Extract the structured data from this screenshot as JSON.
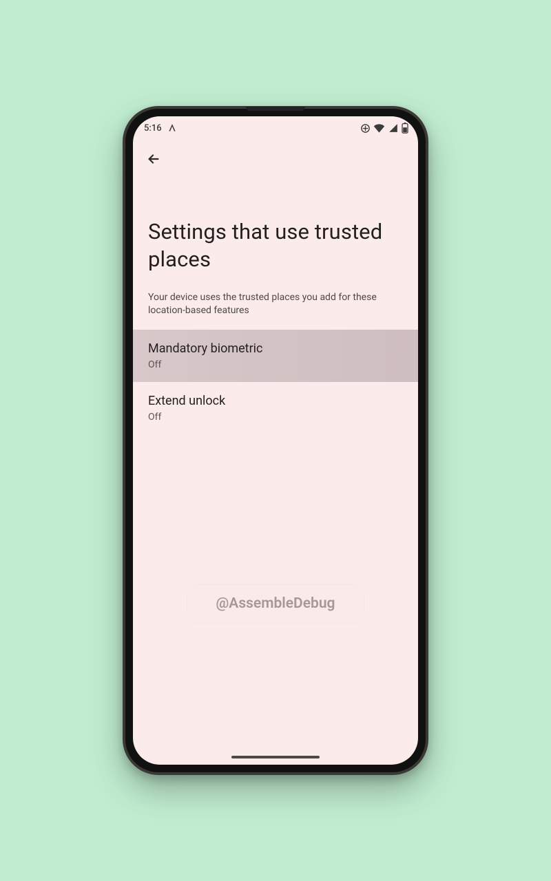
{
  "status": {
    "time": "5:16",
    "icons": {
      "app": "app-running-icon",
      "data": "data-saver-icon",
      "wifi": "wifi-icon",
      "signal": "signal-hd-icon",
      "battery": "battery-icon"
    }
  },
  "page": {
    "title": "Settings that use trusted places",
    "subtitle": "Your device uses the trusted places you add for these location-based features"
  },
  "settings": [
    {
      "title": "Mandatory biometric",
      "value": "Off",
      "highlighted": true
    },
    {
      "title": "Extend unlock",
      "value": "Off",
      "highlighted": false
    }
  ],
  "watermark": "@AssembleDebug"
}
